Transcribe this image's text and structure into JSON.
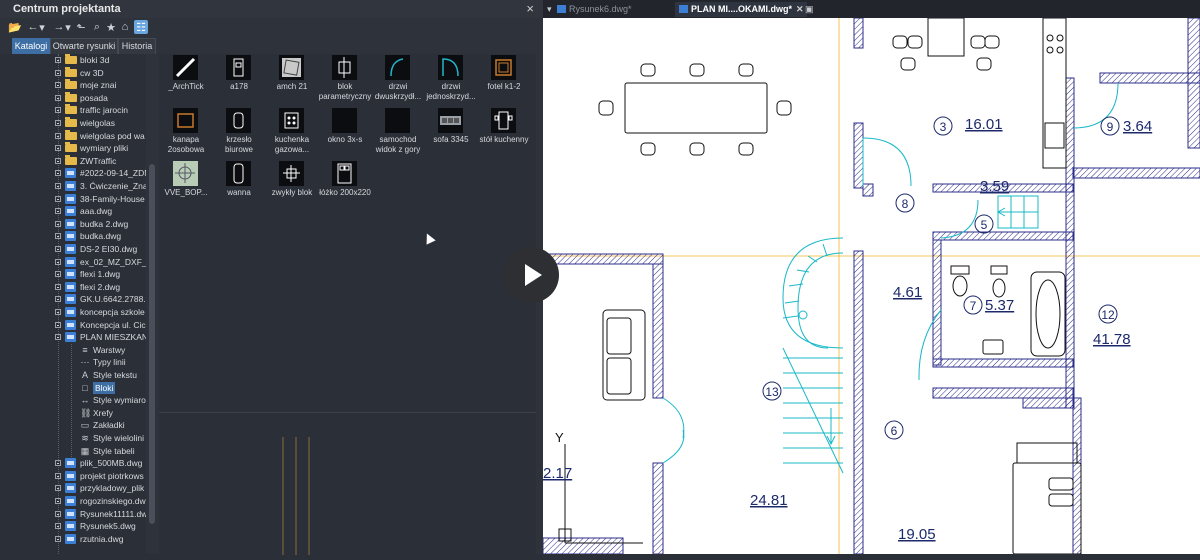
{
  "panel": {
    "title": "Centrum projektanta",
    "close_label": "×"
  },
  "toolbar_icons": [
    "open-folder-icon",
    "back-icon",
    "dropdown-arrow-icon",
    "forward-icon",
    "dropdown-arrow-icon",
    "up-folder-icon",
    "search-icon",
    "favorites-folder-icon",
    "home-icon",
    "tree-view-toggle-icon"
  ],
  "tabs": [
    {
      "label": "Katalogi",
      "active": true
    },
    {
      "label": "Otwarte rysunki",
      "active": false
    },
    {
      "label": "Historia",
      "active": false
    }
  ],
  "tree": [
    {
      "label": "bloki 3d",
      "type": "folder",
      "level": 0,
      "expander": true
    },
    {
      "label": "cw 3D",
      "type": "folder",
      "level": 0,
      "expander": true
    },
    {
      "label": "moje znai",
      "type": "folder",
      "level": 0,
      "expander": true
    },
    {
      "label": "posada",
      "type": "folder",
      "level": 0,
      "expander": true
    },
    {
      "label": "traffic jarocin",
      "type": "folder",
      "level": 0,
      "expander": true
    },
    {
      "label": "wielgolas",
      "type": "folder",
      "level": 0,
      "expander": true
    },
    {
      "label": "wielgolas pod wa",
      "type": "folder",
      "level": 0,
      "expander": true
    },
    {
      "label": "wymiary pliki",
      "type": "folder",
      "level": 0,
      "expander": true
    },
    {
      "label": "ZWTraffic",
      "type": "folder",
      "level": 0,
      "expander": true
    },
    {
      "label": "#2022-09-14_ZDM",
      "type": "dwg",
      "level": 0,
      "expander": true
    },
    {
      "label": "3. Ćwiczenie_Zna",
      "type": "dwg",
      "level": 0,
      "expander": true
    },
    {
      "label": "38-Family-House",
      "type": "dwg",
      "level": 0,
      "expander": true
    },
    {
      "label": "aaa.dwg",
      "type": "dwg",
      "level": 0,
      "expander": true
    },
    {
      "label": "budka 2.dwg",
      "type": "dwg",
      "level": 0,
      "expander": true
    },
    {
      "label": "budka.dwg",
      "type": "dwg",
      "level": 0,
      "expander": true
    },
    {
      "label": "DS-2 EI30.dwg",
      "type": "dwg",
      "level": 0,
      "expander": true
    },
    {
      "label": "ex_02_MZ_DXF_1",
      "type": "dwg",
      "level": 0,
      "expander": true
    },
    {
      "label": "flexi 1.dwg",
      "type": "dwg",
      "level": 0,
      "expander": true
    },
    {
      "label": "flexi 2.dwg",
      "type": "dwg",
      "level": 0,
      "expander": true
    },
    {
      "label": "GK.U.6642.2788.2",
      "type": "dwg",
      "level": 0,
      "expander": true
    },
    {
      "label": "koncepcja szkole",
      "type": "dwg",
      "level": 0,
      "expander": true
    },
    {
      "label": "Koncepcja ul. Cic",
      "type": "dwg",
      "level": 0,
      "expander": true
    },
    {
      "label": "PLAN MIESZKAN",
      "type": "dwg",
      "level": 0,
      "expander": true,
      "expanded": true
    },
    {
      "label": "Warstwy",
      "type": "sub",
      "icon": "layers-icon",
      "glyph": "≡",
      "level": 1
    },
    {
      "label": "Typy linii",
      "type": "sub",
      "icon": "linetype-icon",
      "glyph": "⋯",
      "level": 1
    },
    {
      "label": "Style tekstu",
      "type": "sub",
      "icon": "text-style-icon",
      "glyph": "A",
      "level": 1
    },
    {
      "label": "Bloki",
      "type": "sub",
      "icon": "block-icon",
      "glyph": "□",
      "level": 1,
      "selected": true
    },
    {
      "label": "Style wymiaro",
      "type": "sub",
      "icon": "dimension-style-icon",
      "glyph": "↔",
      "level": 1
    },
    {
      "label": "Xrefy",
      "type": "sub",
      "icon": "xref-icon",
      "glyph": "⛓",
      "level": 1
    },
    {
      "label": "Zakładki",
      "type": "sub",
      "icon": "bookmark-icon",
      "glyph": "▭",
      "level": 1
    },
    {
      "label": "Style wielolini",
      "type": "sub",
      "icon": "multiline-style-icon",
      "glyph": "≋",
      "level": 1
    },
    {
      "label": "Style tabeli",
      "type": "sub",
      "icon": "table-style-icon",
      "glyph": "▦",
      "level": 1
    },
    {
      "label": "plik_500MB.dwg",
      "type": "dwg",
      "level": 0,
      "expander": true
    },
    {
      "label": "projekt piotrkows",
      "type": "dwg",
      "level": 0,
      "expander": true
    },
    {
      "label": "przykladowy_plik",
      "type": "dwg",
      "level": 0,
      "expander": true
    },
    {
      "label": "rogozinskiego.dw",
      "type": "dwg",
      "level": 0,
      "expander": true
    },
    {
      "label": "Rysunek11111.dw",
      "type": "dwg",
      "level": 0,
      "expander": true
    },
    {
      "label": "Rysunek5.dwg",
      "type": "dwg",
      "level": 0,
      "expander": true
    },
    {
      "label": "rzutnia.dwg",
      "type": "dwg",
      "level": 0,
      "expander": true
    }
  ],
  "blocks": [
    {
      "name": "_ArchTick",
      "icon": "arch-tick-icon"
    },
    {
      "name": "a178",
      "icon": "a178-block-icon"
    },
    {
      "name": "amch 21",
      "icon": "amch21-block-icon"
    },
    {
      "name": "blok parametryczny",
      "icon": "parametric-block-icon"
    },
    {
      "name": "drzwi dwuskrzydł...",
      "icon": "double-door-icon"
    },
    {
      "name": "drzwi jednoskrzyd...",
      "icon": "single-door-icon"
    },
    {
      "name": "fotel k1-2",
      "icon": "armchair-icon"
    },
    {
      "name": "kanapa 2osobowa",
      "icon": "sofa-icon"
    },
    {
      "name": "krzesło biurowe",
      "icon": "office-chair-icon"
    },
    {
      "name": "kuchenka gazowa...",
      "icon": "gas-stove-icon"
    },
    {
      "name": "okno 3x-s",
      "icon": "window-icon"
    },
    {
      "name": "samochod widok z gory",
      "icon": "car-icon"
    },
    {
      "name": "sofa 3345",
      "icon": "sofa3345-icon"
    },
    {
      "name": "stół kuchenny",
      "icon": "kitchen-table-icon"
    },
    {
      "name": "VVE_BOP...",
      "icon": "vve-bop-icon"
    },
    {
      "name": "wanna",
      "icon": "bathtub-icon"
    },
    {
      "name": "zwykły blok",
      "icon": "plain-block-icon"
    },
    {
      "name": "łóżko 200x220",
      "icon": "bed-icon"
    }
  ],
  "doc_tabs": [
    {
      "label": "Rysunek6.dwg*",
      "active": false
    },
    {
      "label": "PLAN MI....OKAMI.dwg*",
      "active": true
    }
  ],
  "drawing": {
    "room_labels": [
      {
        "id": "room-3-number",
        "text": "3",
        "circle": true
      },
      {
        "id": "room-3-area",
        "text": "16.01",
        "circle": false
      },
      {
        "id": "room-9-number",
        "text": "9",
        "circle": true
      },
      {
        "id": "room-9-area",
        "text": "3.64",
        "circle": false
      },
      {
        "id": "room-8-number",
        "text": "8",
        "circle": true
      },
      {
        "id": "corridor-area",
        "text": "3.59",
        "circle": false
      },
      {
        "id": "room-5-number",
        "text": "5",
        "circle": true
      },
      {
        "id": "room-area-461",
        "text": "4.61",
        "circle": false
      },
      {
        "id": "room-7-number",
        "text": "7",
        "circle": true
      },
      {
        "id": "room-7-area",
        "text": "5.37",
        "circle": false
      },
      {
        "id": "room-12-number",
        "text": "12",
        "circle": true
      },
      {
        "id": "room-12-area",
        "text": "41.78",
        "circle": false
      },
      {
        "id": "room-13-number",
        "text": "13",
        "circle": true
      },
      {
        "id": "room-6-number",
        "text": "6",
        "circle": true
      },
      {
        "id": "room-area-217",
        "text": "2.17",
        "circle": false
      },
      {
        "id": "room-area-2481",
        "text": "24.81",
        "circle": false
      },
      {
        "id": "room-area-1905",
        "text": "19.05",
        "circle": false
      }
    ],
    "ucs_y_label": "Y"
  },
  "colors": {
    "accent": "#3d6fa5",
    "wall_hatch": "#2c2c8a",
    "stairs": "#19b8c8",
    "guide": "#f0b429",
    "text": "#1c2a6b"
  }
}
